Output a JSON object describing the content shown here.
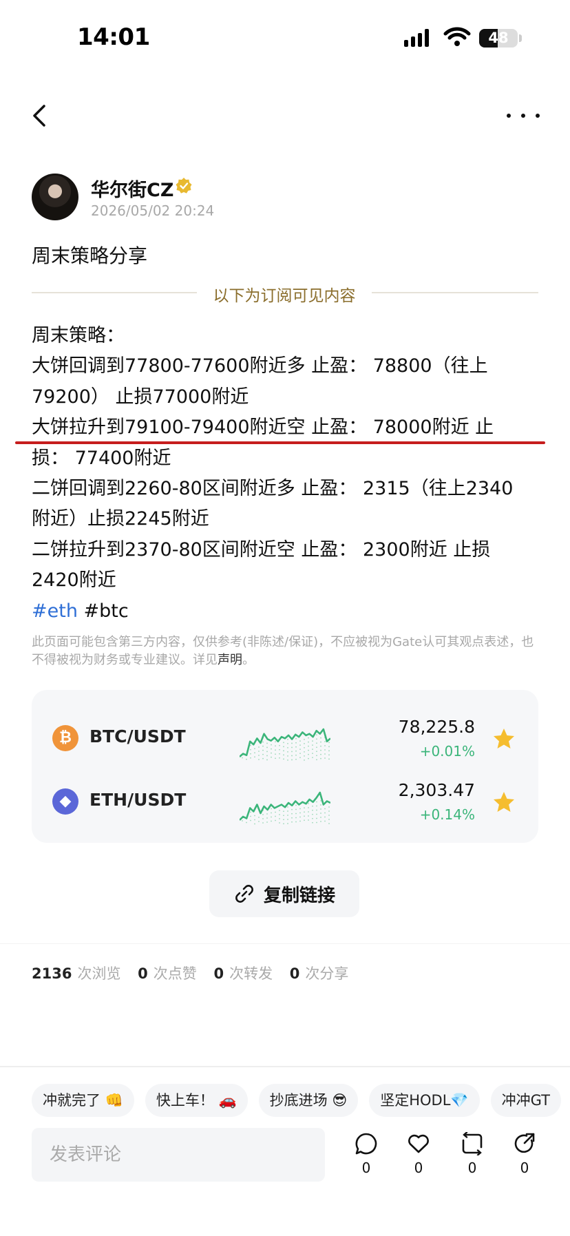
{
  "status_bar": {
    "time": "14:01",
    "battery": "48",
    "battery_level": 0.48
  },
  "nav": {
    "back_icon": "chevron-left-icon",
    "more_icon": "more-dots-icon"
  },
  "author": {
    "name": "华尔街CZ",
    "timestamp": "2026/05/02 20:24",
    "verified_color": "#E8B931"
  },
  "post": {
    "title": "周末策略分享",
    "subscriber_divider": "以下为订阅可见内容",
    "lines": [
      "周末策略：",
      "大饼回调到77800-77600附近多  止盈：  78800（往上",
      "79200）  止损77000附近",
      "大饼拉升到79100-79400附近空  止盈：  78000附近     止",
      "损：  77400附近",
      "二饼回调到2260-80区间附近多   止盈：  2315（往上2340",
      "附近）止损2245附近",
      "二饼拉升到2370-80区间附近空   止盈：  2300附近    止损",
      "2420附近"
    ],
    "tags": [
      "#eth",
      "#btc"
    ],
    "tag_color": "#2F6FD6"
  },
  "disclaimer": {
    "text": "此页面可能包含第三方内容，仅供参考(非陈述/保证)，不应被视为Gate认可其观点表述，也不得被视为财务或专业建议。详见",
    "link": "声明",
    "end": "。"
  },
  "markets": [
    {
      "pair": "BTC/USDT",
      "symbol": "₿",
      "icon": "bitcoin-icon",
      "icon_color": "#F0943A",
      "price": "78,225.8",
      "change": "+0.01%",
      "spark": [
        10,
        14,
        12,
        30,
        26,
        34,
        28,
        40,
        33,
        31,
        35,
        30,
        36,
        34,
        38,
        33,
        39,
        36,
        42,
        38,
        40,
        36,
        44,
        40,
        46,
        30,
        34
      ]
    },
    {
      "pair": "ETH/USDT",
      "symbol": "◆",
      "icon": "ethereum-icon",
      "icon_color": "#5B67D8",
      "price": "2,303.47",
      "change": "+0.14%",
      "spark": [
        12,
        16,
        14,
        26,
        22,
        30,
        20,
        28,
        24,
        30,
        26,
        28,
        30,
        27,
        32,
        29,
        34,
        30,
        33,
        31,
        36,
        33,
        38,
        44,
        30,
        34,
        32
      ]
    }
  ],
  "copy_link": {
    "label": "复制链接",
    "icon": "link-icon"
  },
  "stats": [
    {
      "value": "2136",
      "unit": "次浏览"
    },
    {
      "value": "0",
      "unit": "次点赞"
    },
    {
      "value": "0",
      "unit": "次转发"
    },
    {
      "value": "0",
      "unit": "次分享"
    }
  ],
  "quick_replies": [
    "冲就完了 👊",
    "快上车！ 🚗",
    "抄底进场 😎",
    "坚定HODL💎",
    "冲冲GT"
  ],
  "comment": {
    "placeholder": "发表评论"
  },
  "actions": [
    {
      "name": "comment-icon",
      "count": "0"
    },
    {
      "name": "like-icon",
      "count": "0"
    },
    {
      "name": "repost-icon",
      "count": "0"
    },
    {
      "name": "share-icon",
      "count": "0"
    }
  ]
}
